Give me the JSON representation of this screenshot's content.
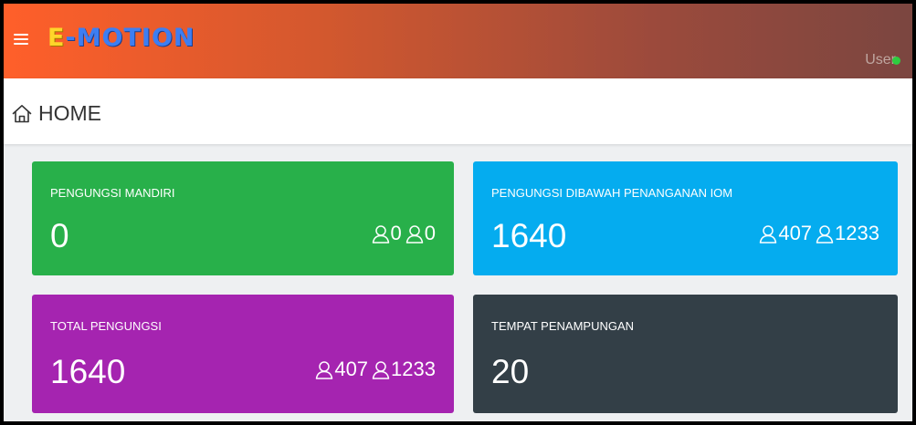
{
  "app": {
    "logo_prefix": "E",
    "logo_rest": "-MOTION",
    "user_label": "User",
    "user_status_color": "#2ecc40"
  },
  "breadcrumb": {
    "icon": "home-icon",
    "label": "HOME"
  },
  "cards": [
    {
      "title": "PENGUNGSI MANDIRI",
      "value": "0",
      "male": "0",
      "female": "0",
      "color": "#28b04a"
    },
    {
      "title": "PENGUNGSI DIBAWAH PENANGANAN IOM",
      "value": "1640",
      "male": "407",
      "female": "1233",
      "color": "#05acef"
    },
    {
      "title": "TOTAL PENGUNGSI",
      "value": "1640",
      "male": "407",
      "female": "1233",
      "color": "#a524b0"
    },
    {
      "title": "TEMPAT PENAMPUNGAN",
      "value": "20",
      "color": "#333f47"
    }
  ]
}
